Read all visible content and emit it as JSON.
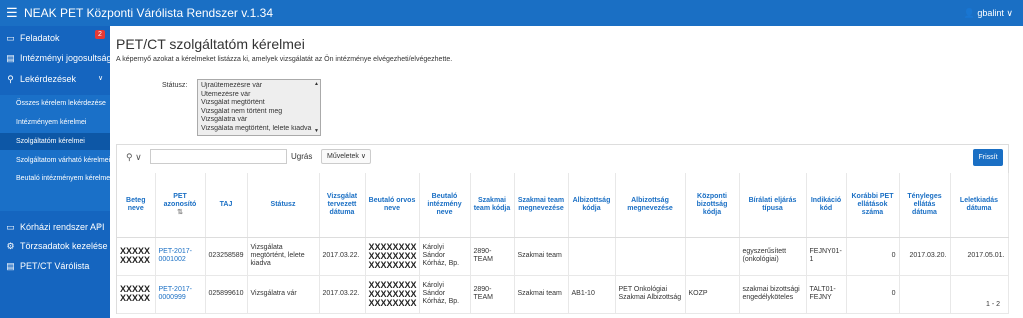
{
  "topbar": {
    "title": "NEAK PET Központi Várólista Rendszer v.1.34",
    "user": "gbalint"
  },
  "sidebar": {
    "items": [
      {
        "label": "Feladatok",
        "icon": "inbox-icon",
        "badge": "2"
      },
      {
        "label": "Intézményi jogosultság ı",
        "icon": "document-icon"
      },
      {
        "label": "Lekérdezések",
        "icon": "search-icon",
        "chevron": "∨"
      },
      {
        "label": "Kórházi rendszer API",
        "icon": "monitor-icon",
        "chevron": "‹"
      },
      {
        "label": "Törzsadatok kezelése",
        "icon": "cogs-icon",
        "chevron": "‹"
      },
      {
        "label": "PET/CT Várólista",
        "icon": "list-icon"
      }
    ],
    "subitems": [
      {
        "label": "Összes kérelem lekérdezése"
      },
      {
        "label": "Intézményem kérelmei"
      },
      {
        "label": "Szolgáltatóm kérelmei"
      },
      {
        "label": "Szolgáltatom várható kérelmei"
      },
      {
        "label": "Beutaló intézményem kérelmei"
      }
    ]
  },
  "page": {
    "title": "PET/CT szolgáltatóm kérelmei",
    "description": "A képernyő azokat a kérelmeket listázza ki, amelyek vizsgálatát az Ön intézménye elvégezheti/elvégezhette."
  },
  "filter": {
    "status_label": "Státusz:",
    "options": [
      "Újraütemezésre vár",
      "Ütemezésre vár",
      "Vizsgálat megtörtént",
      "Vizsgálat nem történt meg",
      "Vizsgálatra vár",
      "Vizsgálata megtörtént, lelete kiadva"
    ]
  },
  "toolbar": {
    "go_label": "Ugrás",
    "actions_label": "Műveletek",
    "refresh_label": "Frissít"
  },
  "table": {
    "headers": [
      "Beteg neve",
      "PET azonosító",
      "TAJ",
      "Státusz",
      "Vizsgálat tervezett dátuma",
      "Beutaló orvos neve",
      "Beutaló intézmény neve",
      "Szakmai team kódja",
      "Szakmai team megnevezése",
      "Albizottság kódja",
      "Albizottság megnevezése",
      "Központi bizottság kódja",
      "Bírálati eljárás típusa",
      "Indikáció kód",
      "Korábbi PET ellátások száma",
      "Tényleges ellátás dátuma",
      "Leletkiadás dátuma"
    ],
    "rows": [
      [
        "XXXXX XXXXX",
        "PET-2017-0001002",
        "023258589",
        "Vizsgálata megtörtént, lelete kiadva",
        "2017.03.22.",
        "XXXXXXXX XXXXXXXX XXXXXXXX",
        "Károlyi Sándor Kórház, Bp.",
        "2890-TEAM",
        "Szakmai team",
        "",
        "",
        "",
        "egyszerűsített (onkológiai)",
        "FEJNY01-1",
        "0",
        "2017.03.20.",
        "2017.05.01."
      ],
      [
        "XXXXX XXXXX",
        "PET-2017-0000999",
        "025899610",
        "Vizsgálatra vár",
        "2017.03.22.",
        "XXXXXXXX XXXXXXXX XXXXXXXX",
        "Károlyi Sándor Kórház, Bp.",
        "2890-TEAM",
        "Szakmai team",
        "AB1-10",
        "PET Onkológiai Szakmai Albizottság",
        "KOZP",
        "szakmai bizottsági engedélyköteles",
        "TALT01-FEJNY",
        "0",
        "",
        ""
      ]
    ]
  },
  "pagination": "1 - 2"
}
